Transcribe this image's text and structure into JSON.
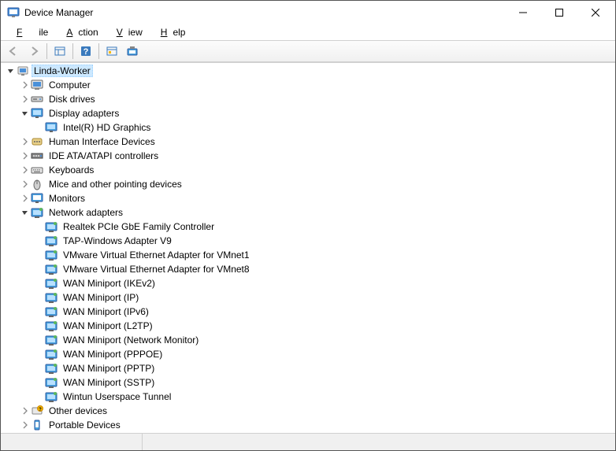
{
  "window": {
    "title": "Device Manager"
  },
  "menu": {
    "file": "File",
    "action": "Action",
    "view": "View",
    "help": "Help"
  },
  "tree": {
    "root": {
      "label": "Linda-Worker",
      "expanded": true
    },
    "categories": [
      {
        "label": "Computer",
        "icon": "computer",
        "expanded": false,
        "children": []
      },
      {
        "label": "Disk drives",
        "icon": "disk",
        "expanded": false,
        "children": []
      },
      {
        "label": "Display adapters",
        "icon": "display",
        "expanded": true,
        "children": [
          {
            "label": "Intel(R) HD Graphics",
            "icon": "display"
          }
        ]
      },
      {
        "label": "Human Interface Devices",
        "icon": "hid",
        "expanded": false,
        "children": []
      },
      {
        "label": "IDE ATA/ATAPI controllers",
        "icon": "ide",
        "expanded": false,
        "children": []
      },
      {
        "label": "Keyboards",
        "icon": "keyboard",
        "expanded": false,
        "children": []
      },
      {
        "label": "Mice and other pointing devices",
        "icon": "mouse",
        "expanded": false,
        "children": []
      },
      {
        "label": "Monitors",
        "icon": "monitor",
        "expanded": false,
        "children": []
      },
      {
        "label": "Network adapters",
        "icon": "network",
        "expanded": true,
        "children": [
          {
            "label": "Realtek PCIe GbE Family Controller",
            "icon": "network"
          },
          {
            "label": "TAP-Windows Adapter V9",
            "icon": "network"
          },
          {
            "label": "VMware Virtual Ethernet Adapter for VMnet1",
            "icon": "network"
          },
          {
            "label": "VMware Virtual Ethernet Adapter for VMnet8",
            "icon": "network"
          },
          {
            "label": "WAN Miniport (IKEv2)",
            "icon": "network"
          },
          {
            "label": "WAN Miniport (IP)",
            "icon": "network"
          },
          {
            "label": "WAN Miniport (IPv6)",
            "icon": "network"
          },
          {
            "label": "WAN Miniport (L2TP)",
            "icon": "network"
          },
          {
            "label": "WAN Miniport (Network Monitor)",
            "icon": "network"
          },
          {
            "label": "WAN Miniport (PPPOE)",
            "icon": "network"
          },
          {
            "label": "WAN Miniport (PPTP)",
            "icon": "network"
          },
          {
            "label": "WAN Miniport (SSTP)",
            "icon": "network"
          },
          {
            "label": "Wintun Userspace Tunnel",
            "icon": "network"
          }
        ]
      },
      {
        "label": "Other devices",
        "icon": "other",
        "expanded": false,
        "children": []
      },
      {
        "label": "Portable Devices",
        "icon": "portable",
        "expanded": false,
        "children": []
      }
    ]
  }
}
